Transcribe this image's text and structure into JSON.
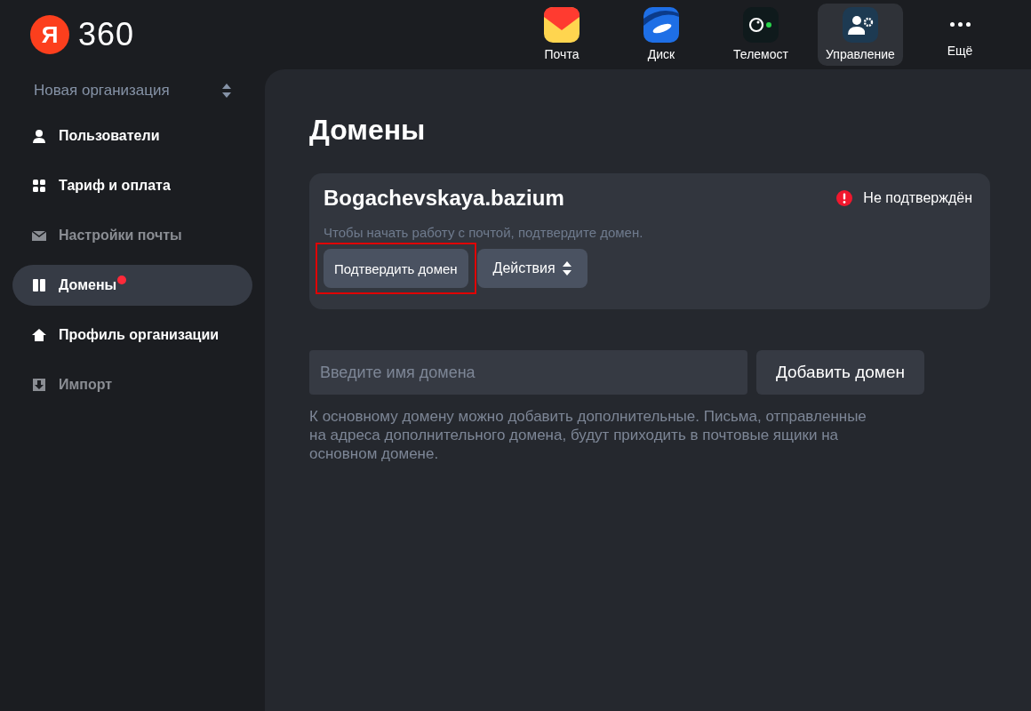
{
  "logo": {
    "letter": "Я",
    "text": "360"
  },
  "apps": [
    {
      "kind": "mail",
      "label": "Почта",
      "selected": false
    },
    {
      "kind": "disk",
      "label": "Диск",
      "selected": false
    },
    {
      "kind": "telemost",
      "label": "Телемост",
      "selected": false
    },
    {
      "kind": "admin",
      "label": "Управление",
      "selected": true
    },
    {
      "kind": "more",
      "label": "Ещё",
      "selected": false
    }
  ],
  "sidebar": {
    "organization": "Новая организация",
    "items": [
      {
        "kind": "user",
        "label": "Пользователи",
        "selected": false,
        "disabled": false,
        "badge": false
      },
      {
        "kind": "grid",
        "label": "Тариф и оплата",
        "selected": false,
        "disabled": false,
        "badge": false
      },
      {
        "kind": "mail",
        "label": "Настройки почты",
        "selected": false,
        "disabled": true,
        "badge": false
      },
      {
        "kind": "domains",
        "label": "Домены",
        "selected": true,
        "disabled": false,
        "badge": true
      },
      {
        "kind": "home",
        "label": "Профиль организации",
        "selected": false,
        "disabled": false,
        "badge": false
      },
      {
        "kind": "import",
        "label": "Импорт",
        "selected": false,
        "disabled": true,
        "badge": false
      }
    ]
  },
  "page": {
    "title": "Домены",
    "domains": [
      {
        "name": "Bogachevskaya.bazium",
        "status": "Не подтверждён",
        "verified": false,
        "hint": "Чтобы начать работу с почтой, подтвердите домен.",
        "buttons": [
          {
            "kind": "primary",
            "label": "Подтвердить домен",
            "highlighted": true
          },
          {
            "kind": "dropdown",
            "label": "Действия",
            "highlighted": false
          }
        ]
      }
    ],
    "add": {
      "placeholder": "Введите имя домена",
      "button": "Добавить домен"
    },
    "note": "К основному домену можно добавить дополнительные. Письма, отправленные на адреса дополнительного домена, будут приходить в почтовые ящики на основном домене."
  }
}
